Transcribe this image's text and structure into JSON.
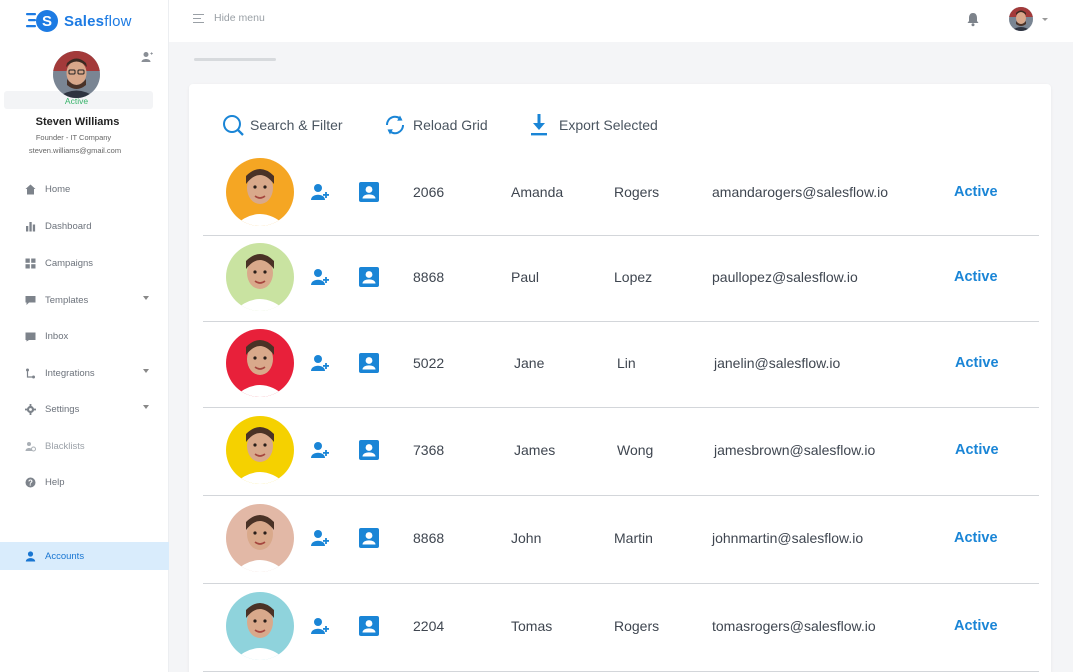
{
  "app": {
    "brand_bold": "Sales",
    "brand_light": "flow"
  },
  "user": {
    "status": "Active",
    "name": "Steven Williams",
    "role": "Founder - IT Company",
    "email": "steven.williams@gmail.com"
  },
  "topbar": {
    "hide_menu": "Hide menu"
  },
  "nav": [
    {
      "label": "Home",
      "icon": "home-icon"
    },
    {
      "label": "Dashboard",
      "icon": "bar-chart-icon"
    },
    {
      "label": "Campaigns",
      "icon": "grid-icon"
    },
    {
      "label": "Templates",
      "icon": "chat-icon",
      "has_caret": true
    },
    {
      "label": "Inbox",
      "icon": "inbox-icon"
    },
    {
      "label": "Integrations",
      "icon": "integrations-icon",
      "has_caret": true
    },
    {
      "label": "Settings",
      "icon": "gear-icon",
      "has_caret": true
    },
    {
      "label": "Blacklists",
      "icon": "blacklist-icon"
    },
    {
      "label": "Help",
      "icon": "help-icon"
    },
    {
      "label": "Accounts",
      "icon": "user-icon",
      "active": true
    }
  ],
  "toolbar": {
    "search": "Search & Filter",
    "reload": "Reload Grid",
    "export": "Export Selected"
  },
  "colors": {
    "accent": "#1a85d6",
    "active_green": "#37b36a",
    "nav_active_bg": "#d9ecfc"
  },
  "accounts": [
    {
      "id": "2066",
      "first": "Amanda",
      "last": "Rogers",
      "email": "amandarogers@salesflow.io",
      "status": "Active",
      "avatar_bg": "#f5a623"
    },
    {
      "id": "8868",
      "first": "Paul",
      "last": "Lopez",
      "email": "paullopez@salesflow.io",
      "status": "Active",
      "avatar_bg": "#c9e3a1"
    },
    {
      "id": "5022",
      "first": "Jane",
      "last": "Lin",
      "email": "janelin@salesflow.io",
      "status": "Active",
      "avatar_bg": "#e8203a"
    },
    {
      "id": "7368",
      "first": "James",
      "last": "Wong",
      "email": "jamesbrown@salesflow.io",
      "status": "Active",
      "avatar_bg": "#f5d100"
    },
    {
      "id": "8868",
      "first": "John",
      "last": "Martin",
      "email": "johnmartin@salesflow.io",
      "status": "Active",
      "avatar_bg": "#e2b8a6"
    },
    {
      "id": "2204",
      "first": "Tomas",
      "last": "Rogers",
      "email": "tomasrogers@salesflow.io",
      "status": "Active",
      "avatar_bg": "#8fd3dc"
    }
  ]
}
